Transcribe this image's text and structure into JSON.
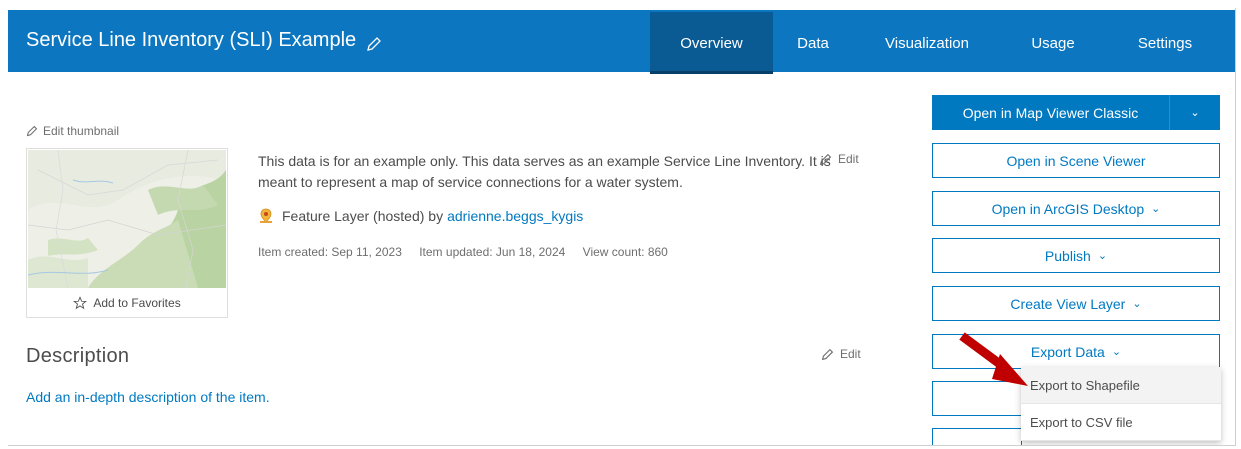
{
  "header": {
    "title": "Service Line Inventory (SLI) Example",
    "tabs": [
      "Overview",
      "Data",
      "Visualization",
      "Usage",
      "Settings"
    ],
    "active_tab": "Overview"
  },
  "thumbnail": {
    "edit_label": "Edit thumbnail",
    "favorites_label": "Add to Favorites"
  },
  "summary": {
    "text": "This data is for an example only. This data serves as an example Service Line Inventory. It is meant to represent a map of service connections for a water system.",
    "edit_label": "Edit"
  },
  "item": {
    "type_prefix": "Feature Layer (hosted) by",
    "owner": "adrienne.beggs_kygis",
    "created": "Item created: Sep 11, 2023",
    "updated": "Item updated: Jun 18, 2024",
    "views": "View count: 860"
  },
  "description": {
    "heading": "Description",
    "edit_label": "Edit",
    "placeholder_link": "Add an in-depth description of the item."
  },
  "actions": {
    "map_viewer": "Open in Map Viewer Classic",
    "scene_viewer": "Open in Scene Viewer",
    "arcgis_desktop": "Open in ArcGIS Desktop",
    "publish": "Publish",
    "create_view_layer": "Create View Layer",
    "export_data": "Export Data"
  },
  "export_menu": {
    "items": [
      "Export to Shapefile",
      "Export to CSV file"
    ]
  },
  "colors": {
    "brand_blue": "#0c77c0",
    "active_tab": "#0a5b94",
    "link_blue": "#0079c1",
    "annotation_arrow": "#c00000"
  }
}
